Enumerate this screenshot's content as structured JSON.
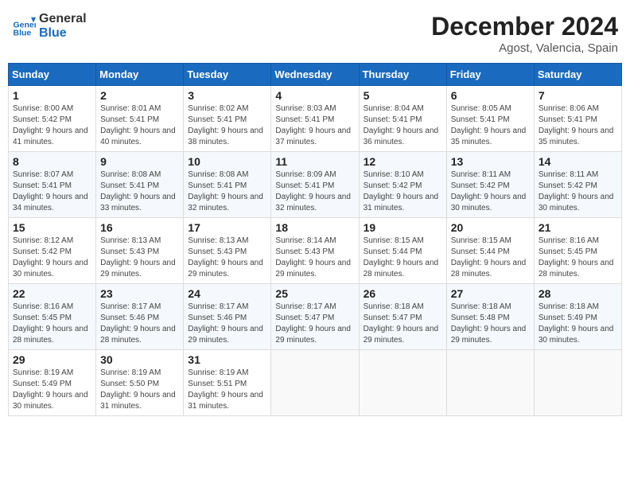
{
  "logo": {
    "line1": "General",
    "line2": "Blue"
  },
  "title": "December 2024",
  "subtitle": "Agost, Valencia, Spain",
  "headers": [
    "Sunday",
    "Monday",
    "Tuesday",
    "Wednesday",
    "Thursday",
    "Friday",
    "Saturday"
  ],
  "weeks": [
    [
      {
        "day": "1",
        "sunrise": "8:00 AM",
        "sunset": "5:42 PM",
        "daylight": "9 hours and 41 minutes."
      },
      {
        "day": "2",
        "sunrise": "8:01 AM",
        "sunset": "5:41 PM",
        "daylight": "9 hours and 40 minutes."
      },
      {
        "day": "3",
        "sunrise": "8:02 AM",
        "sunset": "5:41 PM",
        "daylight": "9 hours and 38 minutes."
      },
      {
        "day": "4",
        "sunrise": "8:03 AM",
        "sunset": "5:41 PM",
        "daylight": "9 hours and 37 minutes."
      },
      {
        "day": "5",
        "sunrise": "8:04 AM",
        "sunset": "5:41 PM",
        "daylight": "9 hours and 36 minutes."
      },
      {
        "day": "6",
        "sunrise": "8:05 AM",
        "sunset": "5:41 PM",
        "daylight": "9 hours and 35 minutes."
      },
      {
        "day": "7",
        "sunrise": "8:06 AM",
        "sunset": "5:41 PM",
        "daylight": "9 hours and 35 minutes."
      }
    ],
    [
      {
        "day": "8",
        "sunrise": "8:07 AM",
        "sunset": "5:41 PM",
        "daylight": "9 hours and 34 minutes."
      },
      {
        "day": "9",
        "sunrise": "8:08 AM",
        "sunset": "5:41 PM",
        "daylight": "9 hours and 33 minutes."
      },
      {
        "day": "10",
        "sunrise": "8:08 AM",
        "sunset": "5:41 PM",
        "daylight": "9 hours and 32 minutes."
      },
      {
        "day": "11",
        "sunrise": "8:09 AM",
        "sunset": "5:41 PM",
        "daylight": "9 hours and 32 minutes."
      },
      {
        "day": "12",
        "sunrise": "8:10 AM",
        "sunset": "5:42 PM",
        "daylight": "9 hours and 31 minutes."
      },
      {
        "day": "13",
        "sunrise": "8:11 AM",
        "sunset": "5:42 PM",
        "daylight": "9 hours and 30 minutes."
      },
      {
        "day": "14",
        "sunrise": "8:11 AM",
        "sunset": "5:42 PM",
        "daylight": "9 hours and 30 minutes."
      }
    ],
    [
      {
        "day": "15",
        "sunrise": "8:12 AM",
        "sunset": "5:42 PM",
        "daylight": "9 hours and 30 minutes."
      },
      {
        "day": "16",
        "sunrise": "8:13 AM",
        "sunset": "5:43 PM",
        "daylight": "9 hours and 29 minutes."
      },
      {
        "day": "17",
        "sunrise": "8:13 AM",
        "sunset": "5:43 PM",
        "daylight": "9 hours and 29 minutes."
      },
      {
        "day": "18",
        "sunrise": "8:14 AM",
        "sunset": "5:43 PM",
        "daylight": "9 hours and 29 minutes."
      },
      {
        "day": "19",
        "sunrise": "8:15 AM",
        "sunset": "5:44 PM",
        "daylight": "9 hours and 28 minutes."
      },
      {
        "day": "20",
        "sunrise": "8:15 AM",
        "sunset": "5:44 PM",
        "daylight": "9 hours and 28 minutes."
      },
      {
        "day": "21",
        "sunrise": "8:16 AM",
        "sunset": "5:45 PM",
        "daylight": "9 hours and 28 minutes."
      }
    ],
    [
      {
        "day": "22",
        "sunrise": "8:16 AM",
        "sunset": "5:45 PM",
        "daylight": "9 hours and 28 minutes."
      },
      {
        "day": "23",
        "sunrise": "8:17 AM",
        "sunset": "5:46 PM",
        "daylight": "9 hours and 28 minutes."
      },
      {
        "day": "24",
        "sunrise": "8:17 AM",
        "sunset": "5:46 PM",
        "daylight": "9 hours and 29 minutes."
      },
      {
        "day": "25",
        "sunrise": "8:17 AM",
        "sunset": "5:47 PM",
        "daylight": "9 hours and 29 minutes."
      },
      {
        "day": "26",
        "sunrise": "8:18 AM",
        "sunset": "5:47 PM",
        "daylight": "9 hours and 29 minutes."
      },
      {
        "day": "27",
        "sunrise": "8:18 AM",
        "sunset": "5:48 PM",
        "daylight": "9 hours and 29 minutes."
      },
      {
        "day": "28",
        "sunrise": "8:18 AM",
        "sunset": "5:49 PM",
        "daylight": "9 hours and 30 minutes."
      }
    ],
    [
      {
        "day": "29",
        "sunrise": "8:19 AM",
        "sunset": "5:49 PM",
        "daylight": "9 hours and 30 minutes."
      },
      {
        "day": "30",
        "sunrise": "8:19 AM",
        "sunset": "5:50 PM",
        "daylight": "9 hours and 31 minutes."
      },
      {
        "day": "31",
        "sunrise": "8:19 AM",
        "sunset": "5:51 PM",
        "daylight": "9 hours and 31 minutes."
      },
      null,
      null,
      null,
      null
    ]
  ]
}
